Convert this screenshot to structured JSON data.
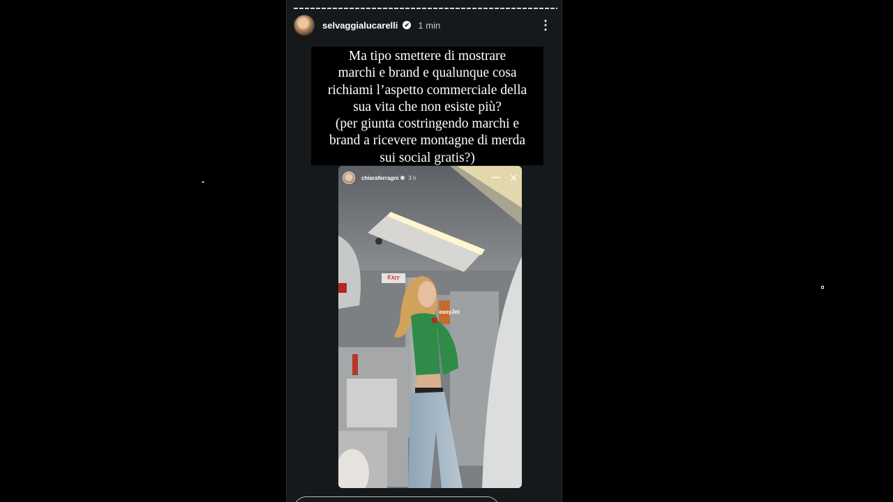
{
  "story": {
    "username": "selvaggialucarelli",
    "time": "1 min",
    "verified_glyph": "✔",
    "more_glyph": "⋮",
    "caption": "Ma tipo smettere di mostrare\nmarchi e brand e qualunque cosa\nrichiami l’aspetto commerciale della\nsua vita che non esiste più?\n(per giunta costringendo marchi e\nbrand a ricevere montagne di merda\nsui social  gratis?)"
  },
  "embedded_story": {
    "username": "chiaraferragni",
    "time": "3 h",
    "more_glyph": "•••",
    "close_glyph": "✕",
    "exit_sign": "EXIT",
    "screen_label": "easyJet"
  },
  "icons": {
    "avatar": "profile-photo",
    "verified": "verified-badge-icon",
    "more": "more-vertical-icon",
    "close": "close-icon"
  }
}
